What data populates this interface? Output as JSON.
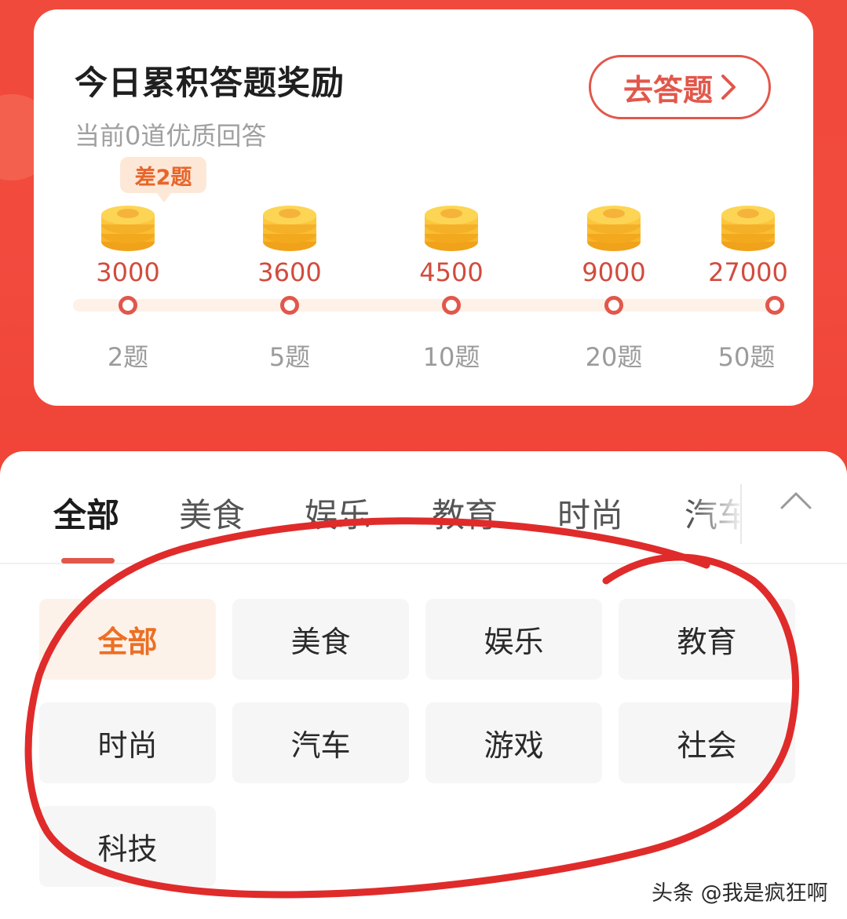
{
  "reward_card": {
    "title": "今日累积答题奖励",
    "subtitle": "当前0道优质回答",
    "go_button": "去答题",
    "badge": "差2题",
    "milestones": [
      {
        "reward": "3000",
        "questions": "2题"
      },
      {
        "reward": "3600",
        "questions": "5题"
      },
      {
        "reward": "4500",
        "questions": "10题"
      },
      {
        "reward": "9000",
        "questions": "20题"
      },
      {
        "reward": "27000",
        "questions": "50题"
      }
    ]
  },
  "tabs": [
    {
      "label": "全部",
      "active": true
    },
    {
      "label": "美食"
    },
    {
      "label": "娱乐"
    },
    {
      "label": "教育"
    },
    {
      "label": "时尚"
    },
    {
      "label": "汽车"
    }
  ],
  "categories": [
    {
      "label": "全部",
      "selected": true
    },
    {
      "label": "美食"
    },
    {
      "label": "娱乐"
    },
    {
      "label": "教育"
    },
    {
      "label": "时尚"
    },
    {
      "label": "汽车"
    },
    {
      "label": "游戏"
    },
    {
      "label": "社会"
    },
    {
      "label": "科技"
    }
  ],
  "watermark": "头条 @我是疯狂啊",
  "colors": {
    "accent": "#e2574b",
    "selected_text": "#ec6f24",
    "header_bg": "#f04a3c",
    "annotation_stroke": "#e02b2b"
  }
}
